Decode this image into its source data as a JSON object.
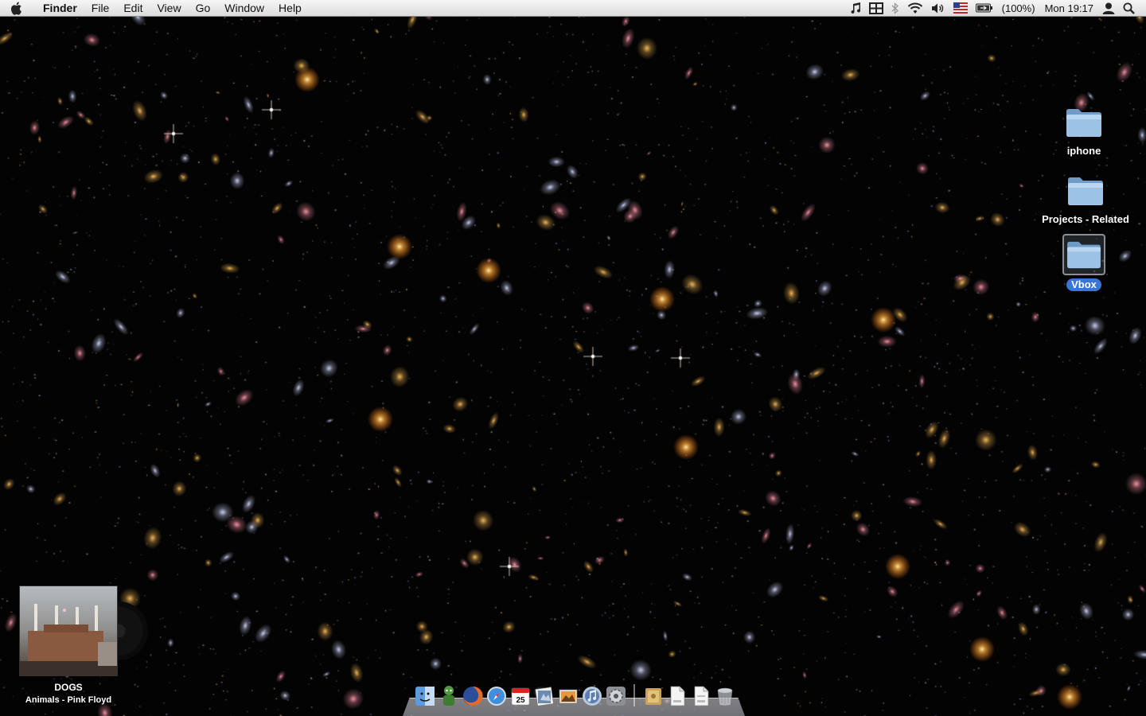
{
  "menubar": {
    "app_name": "Finder",
    "menus": [
      "File",
      "Edit",
      "View",
      "Go",
      "Window",
      "Help"
    ],
    "battery_text": "(100%)",
    "clock": "Mon 19:17",
    "status_icons": [
      "itunes-note-icon",
      "spaces-icon",
      "bluetooth-icon",
      "wifi-icon",
      "volume-icon",
      "us-flag-input-icon",
      "battery-icon",
      "user-icon",
      "spotlight-icon"
    ]
  },
  "desktop_icons": [
    {
      "label": "iphone",
      "icon": "folder-icon",
      "selected": false
    },
    {
      "label": "Projects - Related",
      "icon": "folder-icon",
      "selected": false
    },
    {
      "label": "Vbox",
      "icon": "folder-icon",
      "selected": true
    }
  ],
  "now_playing": {
    "track": "DOGS",
    "album_artist": "Animals - Pink Floyd"
  },
  "dock": {
    "items": [
      "finder-icon",
      "automator-icon",
      "firefox-icon",
      "safari-icon",
      "ical-icon",
      "address-book-icon",
      "iphoto-icon",
      "itunes-icon",
      "system-preferences-icon"
    ],
    "calendar_day": "25",
    "stack_items": [
      "applications-stack-icon",
      "documents-stack-icon",
      "downloads-stack-icon",
      "trash-icon"
    ]
  },
  "colors": {
    "menubar_bg": "#e8e8e8",
    "selection_blue": "#3875d7",
    "folder_blue": "#8fb6dc"
  }
}
